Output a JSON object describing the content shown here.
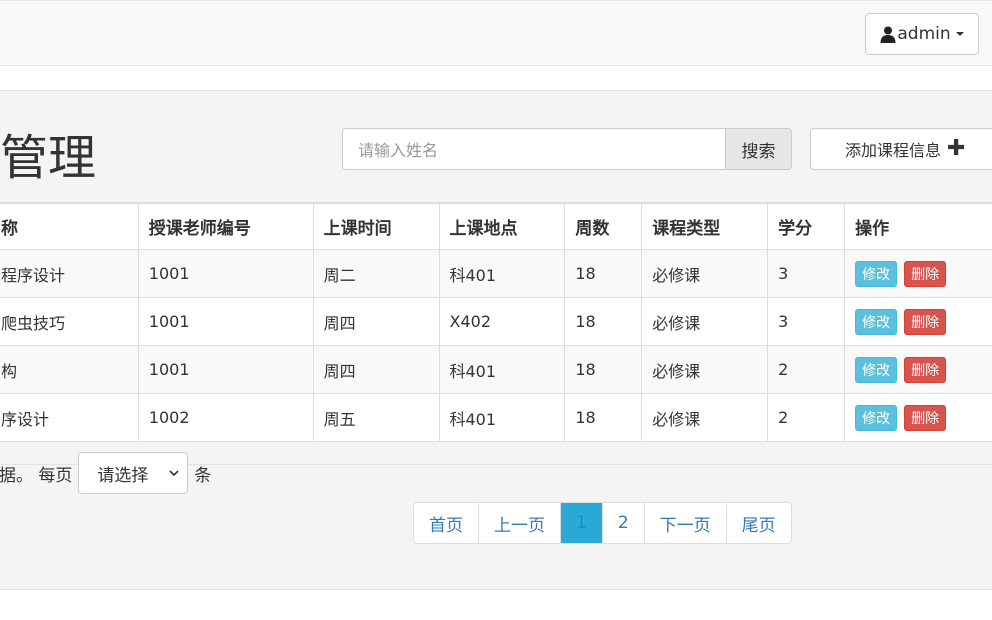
{
  "navbar": {
    "user_label": "admin"
  },
  "page": {
    "title": "单管理"
  },
  "search": {
    "placeholder": "请输入姓名",
    "button_label": "搜索"
  },
  "add_button": {
    "label": "添加课程信息",
    "icon": "plus-icon"
  },
  "table": {
    "headers": [
      "称",
      "授课老师编号",
      "上课时间",
      "上课地点",
      "周数",
      "课程类型",
      "学分",
      "操作"
    ],
    "rows": [
      {
        "name": "程序设计",
        "teacher": "1001",
        "time": "周二",
        "place": "科401",
        "weeks": "18",
        "type": "必修课",
        "credit": "3"
      },
      {
        "name": "爬虫技巧",
        "teacher": "1001",
        "time": "周四",
        "place": "X402",
        "weeks": "18",
        "type": "必修课",
        "credit": "3"
      },
      {
        "name": "构",
        "teacher": "1001",
        "time": "周四",
        "place": "科401",
        "weeks": "18",
        "type": "必修课",
        "credit": "2"
      },
      {
        "name": "序设计",
        "teacher": "1002",
        "time": "周五",
        "place": "科401",
        "weeks": "18",
        "type": "必修课",
        "credit": "2"
      }
    ],
    "edit_label": "修改",
    "delete_label": "删除"
  },
  "page_size": {
    "prefix": "数据。 每页",
    "select_value": "请选择",
    "suffix": "条"
  },
  "pagination": {
    "first": "首页",
    "prev": "上一页",
    "pages": [
      "1",
      "2"
    ],
    "current": "1",
    "next": "下一页",
    "last": "尾页"
  },
  "colors": {
    "accent": "#2aa8d6",
    "edit": "#5bc0de",
    "delete": "#d9534f",
    "link": "#337ab7"
  }
}
